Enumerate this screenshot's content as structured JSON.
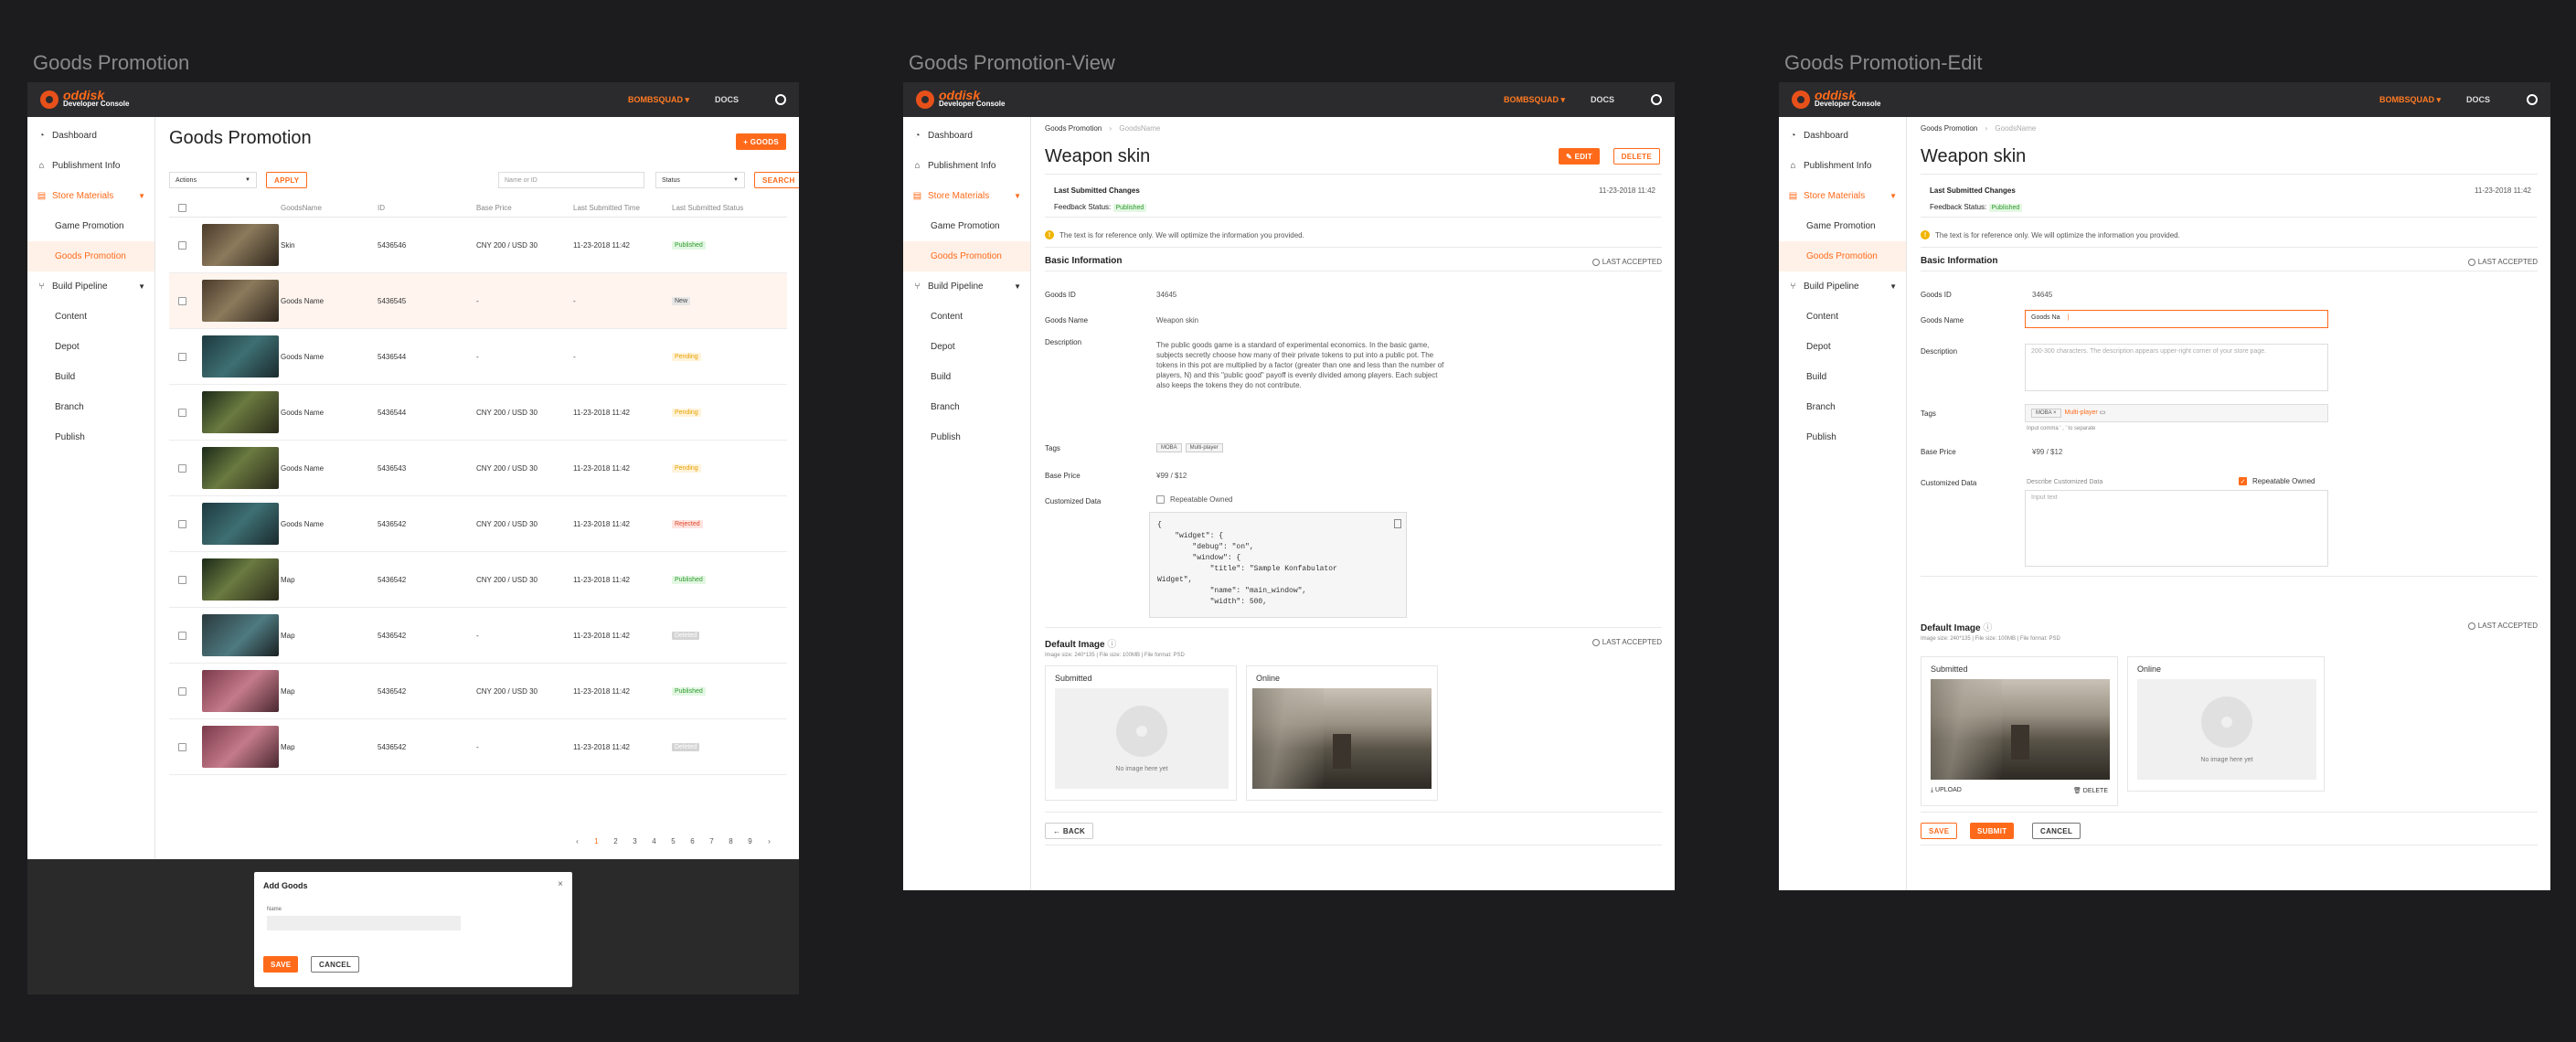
{
  "frames": [
    {
      "title": "Goods Promotion"
    },
    {
      "title": "Goods Promotion-View"
    },
    {
      "title": "Goods Promotion-Edit"
    }
  ],
  "topbar": {
    "logo_name": "oddisk",
    "logo_sub": "Developer Console",
    "user": "BOMBSQUAD ▾",
    "docs": "DOCS"
  },
  "sidebar": {
    "dashboard": "Dashboard",
    "publishment": "Publishment Info",
    "store_materials": "Store Materials",
    "game_promotion": "Game Promotion",
    "goods_promotion": "Goods Promotion",
    "build_pipeline": "Build Pipeline",
    "content": "Content",
    "depot": "Depot",
    "build": "Build",
    "branch": "Branch",
    "publish": "Publish"
  },
  "list": {
    "title": "Goods Promotion",
    "add_button": "+ GOODS",
    "actions": "Actions",
    "apply": "APPLY",
    "search_placeholder": "Name or ID",
    "status": "Status",
    "search": "SEARCH",
    "columns": [
      "GoodsName",
      "ID",
      "Base Price",
      "Last Submitted Time",
      "Last Submitted Status"
    ],
    "rows": [
      {
        "name": "Skin",
        "id": "5436546",
        "price": "CNY 200 / USD 30",
        "time": "11-23-2018 11:42",
        "status": "Published",
        "thumb": "t1"
      },
      {
        "name": "Goods Name",
        "id": "5436545",
        "price": "-",
        "time": "-",
        "status": "New",
        "thumb": "t1"
      },
      {
        "name": "Goods Name",
        "id": "5436544",
        "price": "-",
        "time": "-",
        "status": "Pending",
        "thumb": "t2"
      },
      {
        "name": "Goods Name",
        "id": "5436544",
        "price": "CNY 200 / USD 30",
        "time": "11-23-2018 11:42",
        "status": "Pending",
        "thumb": "t3"
      },
      {
        "name": "Goods Name",
        "id": "5436543",
        "price": "CNY 200 / USD 30",
        "time": "11-23-2018 11:42",
        "status": "Pending",
        "thumb": "t3"
      },
      {
        "name": "Goods Name",
        "id": "5436542",
        "price": "CNY 200 / USD 30",
        "time": "11-23-2018 11:42",
        "status": "Rejected",
        "thumb": "t2"
      },
      {
        "name": "Map",
        "id": "5436542",
        "price": "CNY 200 / USD 30",
        "time": "11-23-2018 11:42",
        "status": "Published",
        "thumb": "t3"
      },
      {
        "name": "Map",
        "id": "5436542",
        "price": "-",
        "time": "11-23-2018 11:42",
        "status": "Deleted",
        "thumb": "t4"
      },
      {
        "name": "Map",
        "id": "5436542",
        "price": "CNY 200 / USD 30",
        "time": "11-23-2018 11:42",
        "status": "Published",
        "thumb": "t5"
      },
      {
        "name": "Map",
        "id": "5436542",
        "price": "-",
        "time": "11-23-2018 11:42",
        "status": "Deleted",
        "thumb": "t5"
      }
    ],
    "pages": [
      "‹",
      "1",
      "2",
      "3",
      "4",
      "5",
      "6",
      "7",
      "8",
      "9",
      "›"
    ],
    "modal": {
      "title": "Add Goods",
      "name_label": "Name",
      "save": "SAVE",
      "cancel": "CANCEL"
    }
  },
  "view": {
    "breadcrumb_root": "Goods Promotion",
    "breadcrumb_current": "GoodsName",
    "title": "Weapon skin",
    "edit": "EDIT",
    "delete": "DELETE",
    "last_changes": "Last Submitted Changes",
    "last_date": "11-23-2018 11:42",
    "feedback_label": "Feedback Status:",
    "feedback_status": "Published",
    "notice": "The text is for reference only. We will optimize the information you provided.",
    "basic_info": "Basic Information",
    "last_accepted": "LAST ACCEPTED",
    "goods_id_label": "Goods ID",
    "goods_id": "34645",
    "goods_name_label": "Goods Name",
    "goods_name": "Weapon skin",
    "description_label": "Description",
    "description": "The public goods game is a standard of experimental economics. In the basic game, subjects secretly choose how many of their private tokens to put into a public pot. The tokens in this pot are multiplied by a factor (greater than one and less than the number of players, N) and this \"public good\" payoff is evenly divided among players. Each subject also keeps the tokens they do not contribute.",
    "tags_label": "Tags",
    "tags": [
      "MOBA",
      "Multi-player"
    ],
    "base_price_label": "Base Price",
    "base_price": "¥99 / $12",
    "custom_label": "Customized Data",
    "repeatable": "Repeatable Owned",
    "code": "{\n    \"widget\": {\n        \"debug\": \"on\",\n        \"window\": {\n            \"title\": \"Sample Konfabulator\nWidget\",\n            \"name\": \"main_window\",\n            \"width\": 500,",
    "default_image": "Default Image",
    "image_spec": "Image size: 240*135  |  File size: 100MB  |  File format: PSD",
    "submitted": "Submitted",
    "online": "Online",
    "no_image": "No image here yet",
    "back": "← BACK"
  },
  "edit": {
    "goods_name_value": "Goods Na",
    "description_placeholder": "200-300 characters. The description appears upper-right corner of your store page.",
    "tag_input": "Multi-player",
    "tags_hint": "Input comma ' , ' to separate",
    "custom_placeholder": "Describe Customized Data",
    "input_text": "Input text",
    "upload": "⤓ UPLOAD",
    "img_delete": "🗑 DELETE",
    "save": "SAVE",
    "submit": "SUBMIT",
    "cancel": "CANCEL"
  },
  "colors": {
    "accent": "#ff6a1a",
    "topbar": "#2b2b2e",
    "background": "#1c1c1e"
  }
}
